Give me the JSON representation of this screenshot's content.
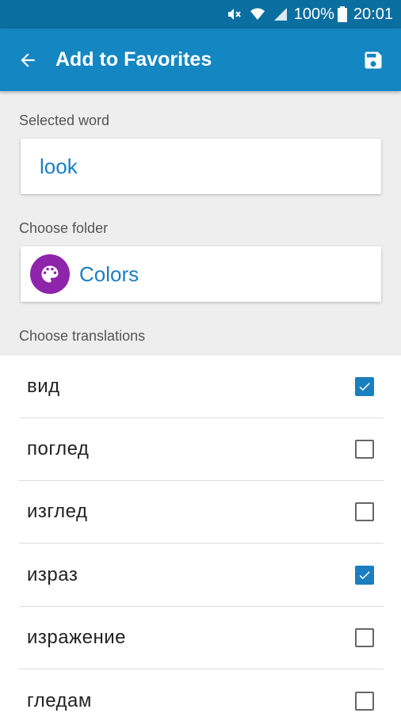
{
  "status_bar": {
    "battery": "100%",
    "time": "20:01"
  },
  "toolbar": {
    "title": "Add to Favorites",
    "back_icon": "arrow-back-icon",
    "save_icon": "save-icon"
  },
  "form": {
    "selected_word_label": "Selected word",
    "selected_word_value": "look",
    "folder_label": "Choose folder",
    "folder_name": "Colors",
    "folder_icon": "palette-icon",
    "folder_color": "#8e24aa",
    "translations_label": "Choose translations"
  },
  "translations": [
    {
      "text": "вид",
      "checked": true
    },
    {
      "text": "поглед",
      "checked": false
    },
    {
      "text": "изглед",
      "checked": false
    },
    {
      "text": "израз",
      "checked": true
    },
    {
      "text": "изражение",
      "checked": false
    },
    {
      "text": "гледам",
      "checked": false
    }
  ],
  "colors": {
    "accent": "#1a7fc1",
    "app_bar": "#1486c2",
    "status_bar": "#0b6ea0"
  }
}
